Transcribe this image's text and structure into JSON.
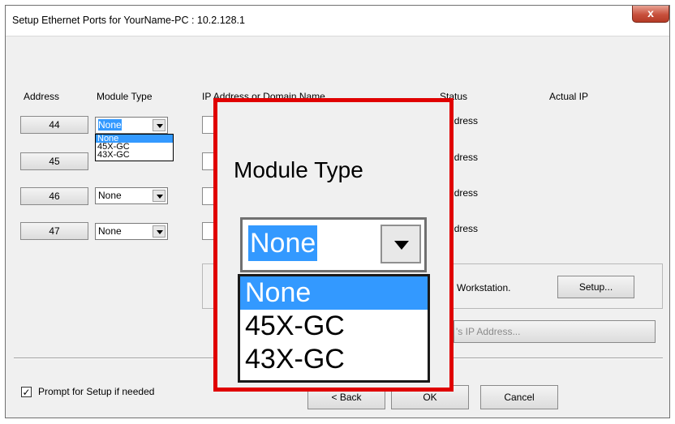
{
  "window": {
    "title": "Setup Ethernet Ports for YourName-PC : 10.2.128.1",
    "close_glyph": "x"
  },
  "columns": {
    "address": "Address",
    "module_type": "Module Type",
    "ip": "IP Address or Domain Name",
    "status": "Status",
    "actual_ip": "Actual IP"
  },
  "rows": [
    {
      "address": "44",
      "module": "None",
      "status": "No Address"
    },
    {
      "address": "45",
      "module": "None",
      "status": "No Address"
    },
    {
      "address": "46",
      "module": "None",
      "status": "No Address"
    },
    {
      "address": "47",
      "module": "None",
      "status": "No Address"
    }
  ],
  "dropdown_options": [
    "None",
    "45X-GC",
    "43X-GC"
  ],
  "workstation": {
    "label": "Workstation.",
    "setup_button": "Setup...",
    "ip_button": "'s IP Address..."
  },
  "footer": {
    "prompt_checkbox_label": "Prompt for Setup if needed",
    "prompt_checked": true,
    "back_button": "< Back",
    "ok_button": "OK",
    "cancel_button": "Cancel"
  },
  "zoom": {
    "heading": "Module Type",
    "selected": "None",
    "options": [
      "None",
      "45X-GC",
      "43X-GC"
    ]
  },
  "colors": {
    "highlight": "#3399ff",
    "zoom_border": "#e00000"
  }
}
